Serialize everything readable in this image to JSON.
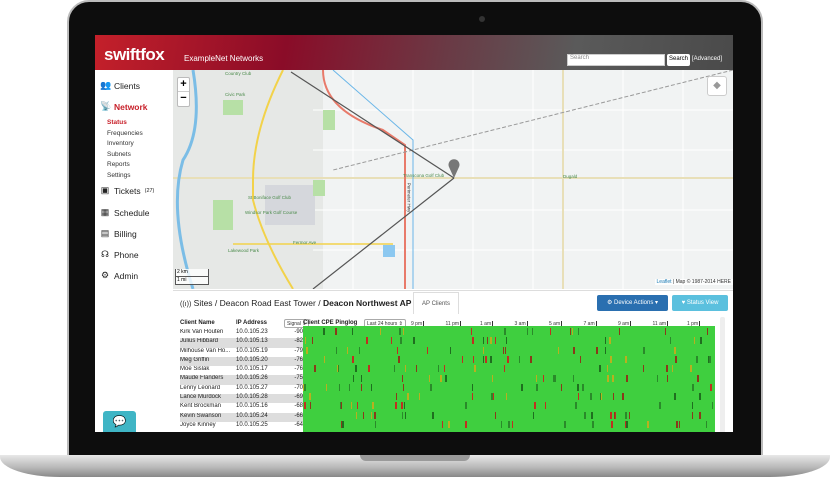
{
  "header": {
    "logo": "swiftfox",
    "org": "ExampleNet Networks",
    "search_placeholder": "Search",
    "search_button": "Search",
    "advanced": "[Advanced]"
  },
  "sidebar": {
    "items": [
      {
        "label": "Clients",
        "icon": "users-icon",
        "glyph": "👥"
      },
      {
        "label": "Network",
        "icon": "antenna-icon",
        "glyph": "📡",
        "active": true
      },
      {
        "label": "Tickets",
        "icon": "inbox-icon",
        "glyph": "▣",
        "badge": "(27)"
      },
      {
        "label": "Schedule",
        "icon": "calendar-icon",
        "glyph": "▦"
      },
      {
        "label": "Billing",
        "icon": "money-icon",
        "glyph": "▤"
      },
      {
        "label": "Phone",
        "icon": "headset-icon",
        "glyph": "☊"
      },
      {
        "label": "Admin",
        "icon": "gears-icon",
        "glyph": "⚙"
      }
    ],
    "network_sub": [
      "Status",
      "Frequencies",
      "Inventory",
      "Subnets",
      "Reports",
      "Settings"
    ],
    "chat_icon": "chat-icon"
  },
  "map": {
    "zoom_in": "+",
    "zoom_out": "−",
    "labels": [
      "Country Club",
      "Civic Park",
      "Transcona Golf Club",
      "St Boniface Golf Club",
      "Windsor Park Golf Course",
      "Fermor Ave",
      "Lakewood Park",
      "Perimeter Hwy",
      "Dugald"
    ],
    "scale_km": "2 km",
    "scale_mi": "1 mi",
    "attribution_link": "Leaflet",
    "attribution": " | Map © 1987-2014 HERE"
  },
  "panel": {
    "breadcrumb": "Sites / Deacon Road East Tower / ",
    "breadcrumb_current": "Deacon Northwest AP",
    "tab": "AP Clients",
    "device_actions": "⚙ Device Actions ▾",
    "status_view": "♥ Status View",
    "columns": {
      "name": "Client Name",
      "ip": "IP Address",
      "signal": "Signal ⇕",
      "pinglog": "Client CPE Pinglog",
      "range": "Last 24 hours ⇕"
    },
    "time_labels": [
      "9 pm",
      "11 pm",
      "1 am",
      "3 am",
      "5 am",
      "7 am",
      "9 am",
      "11 am",
      "1 pm"
    ],
    "rows": [
      {
        "name": "Kirk Van Houten",
        "ip": "10.0.105.23",
        "signal": "-90"
      },
      {
        "name": "Julius Hibbard",
        "ip": "10.0.105.13",
        "signal": "-82"
      },
      {
        "name": "Milhouse Van Ho...",
        "ip": "10.0.105.19",
        "signal": "-79"
      },
      {
        "name": "Meg Griffin",
        "ip": "10.0.105.20",
        "signal": "-76"
      },
      {
        "name": "Moe Sislak",
        "ip": "10.0.105.17",
        "signal": "-76"
      },
      {
        "name": "Maude Flanders",
        "ip": "10.0.105.26",
        "signal": "-75"
      },
      {
        "name": "Lenny Leonard",
        "ip": "10.0.105.27",
        "signal": "-70"
      },
      {
        "name": "Lance Murdock",
        "ip": "10.0.105.28",
        "signal": "-69"
      },
      {
        "name": "Kent Brockman",
        "ip": "10.0.105.16",
        "signal": "-68"
      },
      {
        "name": "Kevin Swanson",
        "ip": "10.0.105.24",
        "signal": "-66"
      },
      {
        "name": "Joyce Kinney",
        "ip": "10.0.105.25",
        "signal": "-64"
      }
    ]
  },
  "colors": {
    "brand": "#c8202a",
    "ping_ok": "#3fcf3f",
    "device_actions": "#2a6fb0",
    "status_view": "#5bc0de"
  }
}
